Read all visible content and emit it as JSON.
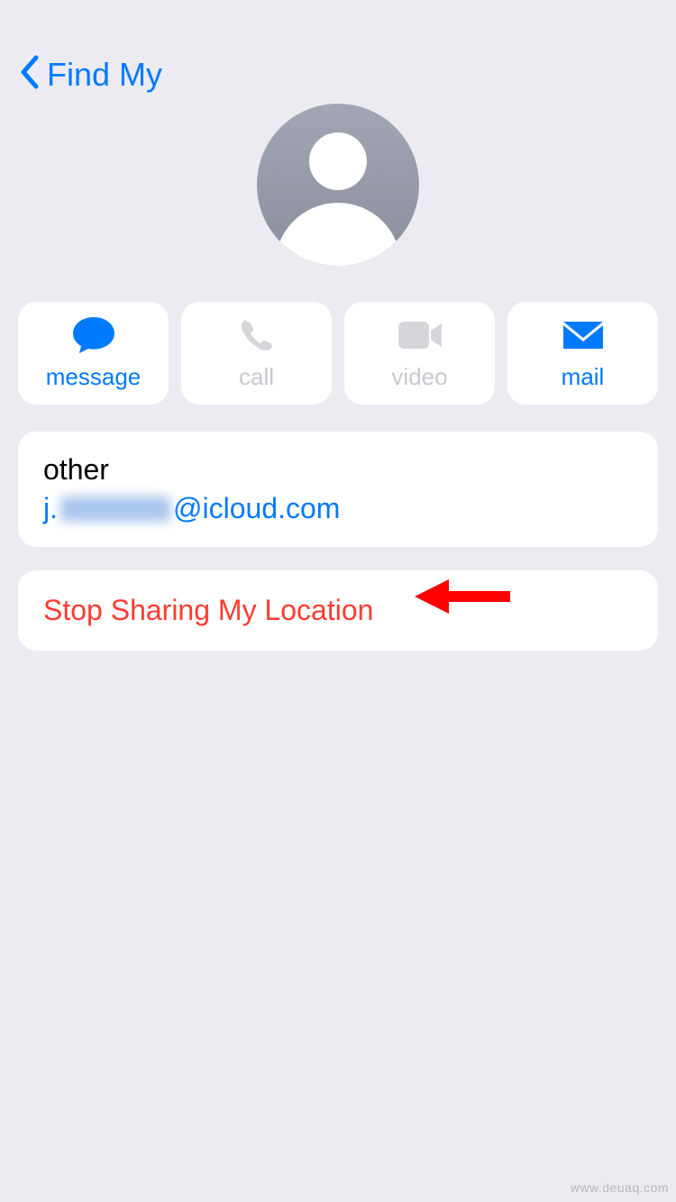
{
  "nav": {
    "back_label": "Find My"
  },
  "actions": {
    "message": "message",
    "call": "call",
    "video": "video",
    "mail": "mail"
  },
  "contact": {
    "type_label": "other",
    "email_prefix": "j.",
    "email_suffix": "@icloud.com"
  },
  "stop_sharing": {
    "label": "Stop Sharing My Location"
  },
  "watermark": "www.deuaq.com",
  "colors": {
    "accent": "#007aff",
    "destructive": "#ff3b30",
    "inactive": "#d6d6da"
  }
}
